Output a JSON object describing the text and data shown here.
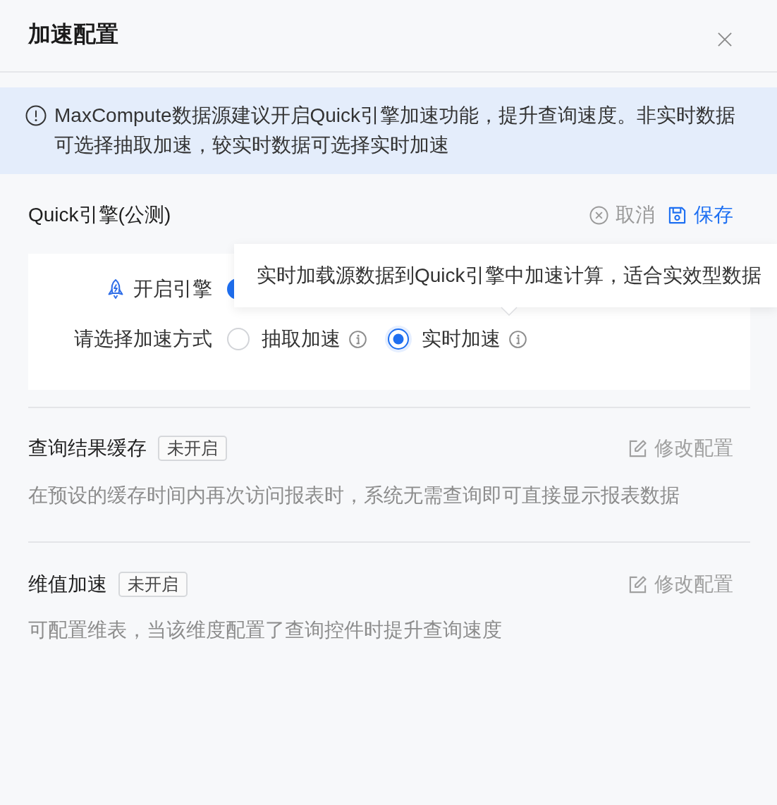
{
  "dialog": {
    "title": "加速配置"
  },
  "alert": {
    "text": "MaxCompute数据源建议开启Quick引擎加速功能，提升查询速度。非实时数据可选择抽取加速，较实时数据可选择实时加速"
  },
  "quick_engine": {
    "title": "Quick引擎(公测)",
    "actions": [
      {
        "kind": "cancel",
        "label": "取消"
      },
      {
        "kind": "save",
        "label": "保存"
      }
    ],
    "engine_switch": {
      "label": "开启引擎",
      "on": true
    },
    "mode": {
      "label": "请选择加速方式",
      "options": [
        {
          "label": "抽取加速",
          "selected": false
        },
        {
          "label": "实时加速",
          "selected": true
        }
      ]
    },
    "tooltip": {
      "text": "实时加载源数据到Quick引擎中加速计算，适合实效型数据"
    }
  },
  "sections": [
    {
      "title": "查询结果缓存",
      "status": "未开启",
      "action": "修改配置",
      "description": "在预设的缓存时间内再次访问报表时，系统无需查询即可直接显示报表数据"
    },
    {
      "title": "维值加速",
      "status": "未开启",
      "action": "修改配置",
      "description": "可配置维表，当该维度配置了查询控件时提升查询速度"
    }
  ]
}
